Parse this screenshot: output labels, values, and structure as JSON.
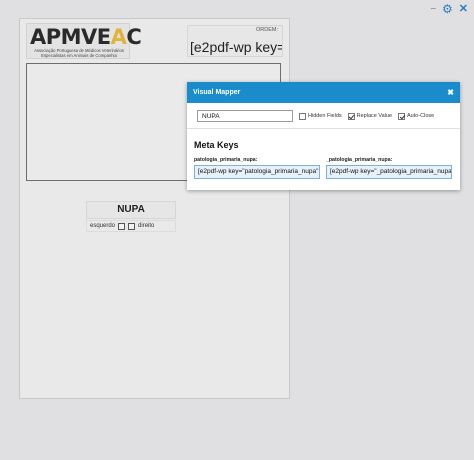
{
  "toolbar": {
    "icons": [
      "minimize-icon",
      "gear-icon",
      "close-icon"
    ],
    "minimize_glyph": "–",
    "gear_glyph": "⚙",
    "close_glyph": "✕"
  },
  "document": {
    "logo": {
      "text_main": "APMVE",
      "text_tri": "A",
      "text_end": "C",
      "subtitle": "Associação Portuguesa de Médicos Veterinários Especialistas em Animais de Companhia"
    },
    "ordem": {
      "label": "ORDEM:",
      "value": "[e2pdf-wp key="
    },
    "section_title": "NUPA",
    "side": {
      "left_label": "esquerdo",
      "right_label": "direito"
    }
  },
  "visual_mapper": {
    "title": "Visual Mapper",
    "close_glyph": "✖",
    "search_value": "NUPA",
    "options": [
      {
        "label": "Hidden Fields",
        "checked": false
      },
      {
        "label": "Replace Value",
        "checked": true
      },
      {
        "label": "Auto-Close",
        "checked": true
      }
    ],
    "meta_title": "Meta Keys",
    "keys": [
      {
        "label": "patologia_primaria_nupa:",
        "value": "[e2pdf-wp key=\"patologia_primaria_nupa\""
      },
      {
        "label": "_patologia_primaria_nupa:",
        "value": "[e2pdf-wp key=\"_patologia_primaria_nupa\""
      }
    ]
  },
  "colors": {
    "accent": "#1a8ccc",
    "logo_yellow": "#e1b33a"
  }
}
